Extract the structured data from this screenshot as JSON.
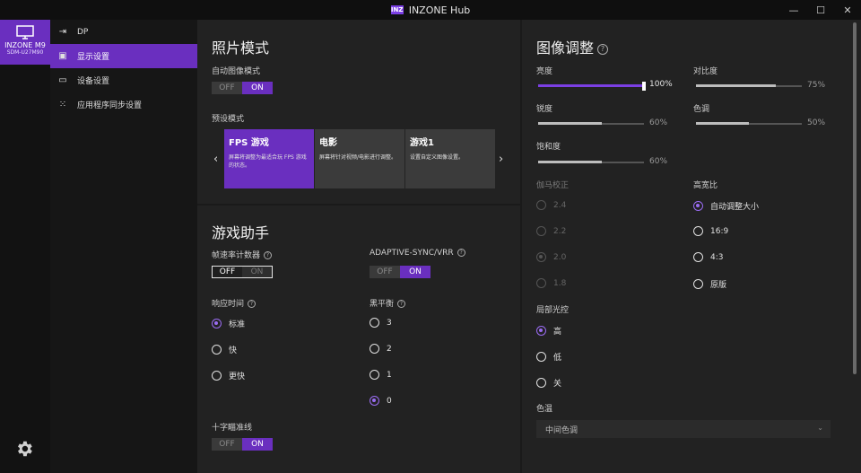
{
  "window": {
    "title": "INZONE Hub",
    "logo": "INZ",
    "minimize": "—",
    "maximize": "☐",
    "close": "✕"
  },
  "device": {
    "name": "INZONE M9",
    "model": "SDM-U27M90"
  },
  "nav": {
    "items": [
      {
        "icon": "input-icon",
        "label": "DP"
      },
      {
        "icon": "image-icon",
        "label": "显示设置"
      },
      {
        "icon": "monitor-icon",
        "label": "设备设置"
      },
      {
        "icon": "grid-icon",
        "label": "应用程序同步设置"
      }
    ]
  },
  "photo": {
    "title": "照片模式",
    "auto_label": "自动图像模式",
    "auto_toggle": {
      "off": "OFF",
      "on": "ON",
      "value": "ON"
    },
    "preset_label": "预设模式",
    "cards": [
      {
        "title": "FPS 游戏",
        "desc": "屏幕将调整为最适合玩 FPS 游戏的状态。"
      },
      {
        "title": "电影",
        "desc": "屏幕将针对视频/电影进行调整。"
      },
      {
        "title": "游戏1",
        "desc": "设置自定义图像设置。"
      }
    ]
  },
  "game": {
    "title": "游戏助手",
    "fps_label": "帧速率计数器",
    "fps_toggle": {
      "off": "OFF",
      "on": "ON",
      "value": "OFF"
    },
    "vrr_label": "ADAPTIVE-SYNC/VRR",
    "vrr_toggle": {
      "off": "OFF",
      "on": "ON",
      "value": "ON"
    },
    "response_label": "响应时间",
    "response_options": [
      "标准",
      "快",
      "更快"
    ],
    "response_value": "标准",
    "black_label": "黑平衡",
    "black_options": [
      "3",
      "2",
      "1",
      "0"
    ],
    "black_value": "0",
    "crosshair_label": "十字瞄准线",
    "crosshair_toggle": {
      "off": "OFF",
      "on": "ON",
      "value": "ON"
    }
  },
  "image": {
    "title": "图像调整",
    "brightness": {
      "label": "亮度",
      "value": "100%",
      "level": 1.0
    },
    "contrast": {
      "label": "对比度",
      "value": "75%",
      "level": 0.75
    },
    "sharpness": {
      "label": "锐度",
      "value": "60%",
      "level": 0.6
    },
    "hue": {
      "label": "色调",
      "value": "50%",
      "level": 0.5
    },
    "saturation": {
      "label": "饱和度",
      "value": "60%",
      "level": 0.6
    },
    "gamma_label": "伽马校正",
    "gamma_options": [
      "2.4",
      "2.2",
      "2.0",
      "1.8"
    ],
    "gamma_value": "2.0",
    "aspect_label": "高宽比",
    "aspect_options": [
      "自动调整大小",
      "16:9",
      "4:3",
      "原版"
    ],
    "aspect_value": "自动调整大小",
    "dimming_label": "局部光控",
    "dimming_options": [
      "高",
      "低",
      "关"
    ],
    "dimming_value": "高",
    "color_temp_label": "色温",
    "color_temp_value": "中间色调"
  },
  "colors": {
    "accent": "#6a2fbf",
    "accent_light": "#9a6cf2"
  }
}
